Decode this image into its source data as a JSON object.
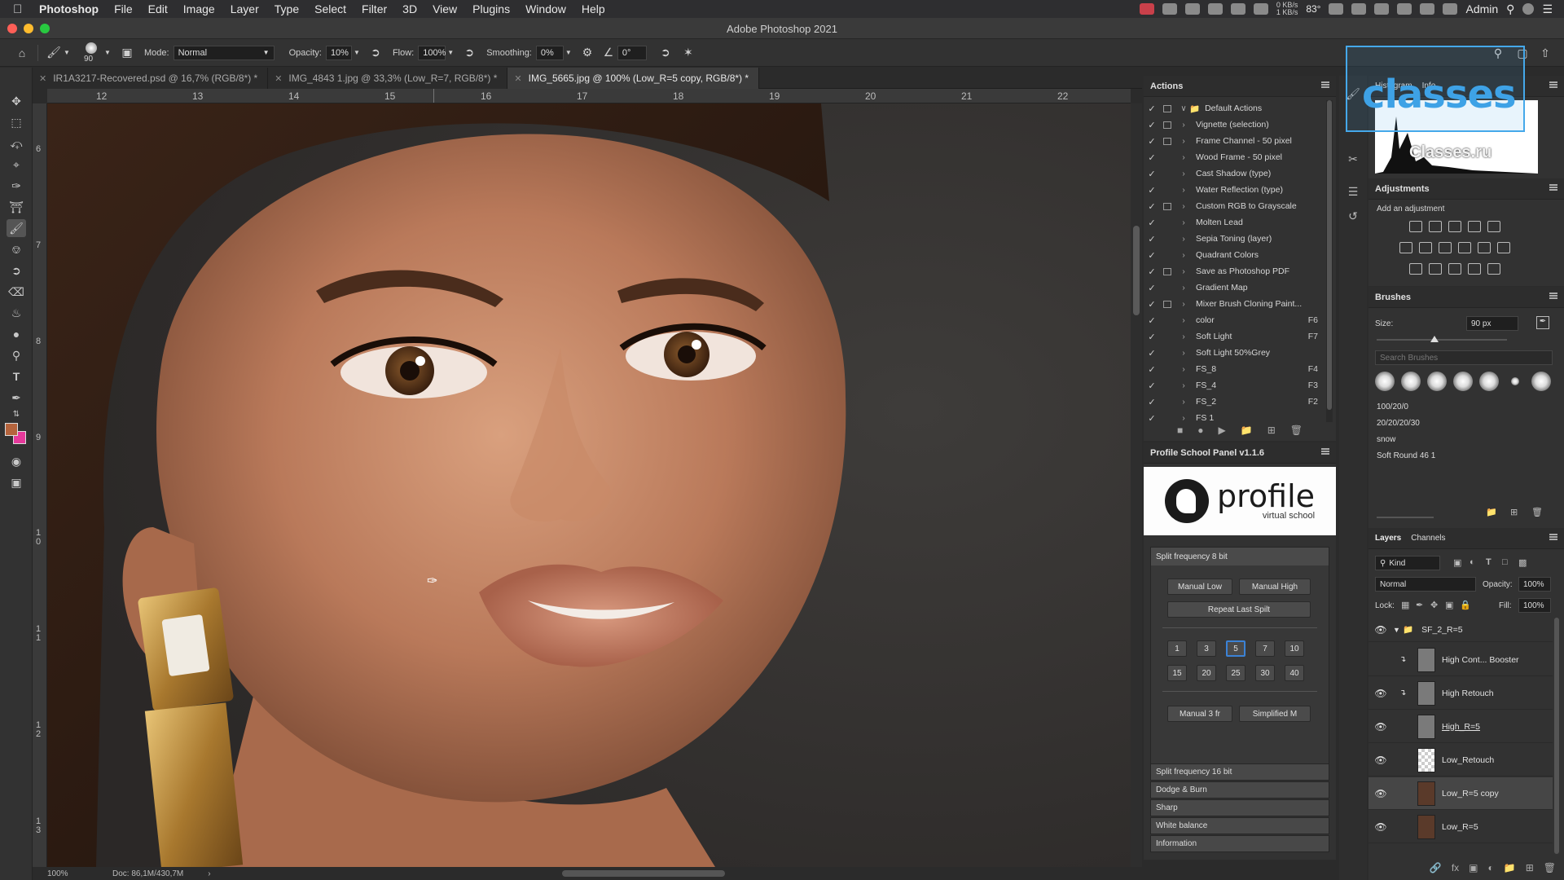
{
  "menubar": {
    "app": "Photoshop",
    "items": [
      "File",
      "Edit",
      "Image",
      "Layer",
      "Type",
      "Select",
      "Filter",
      "3D",
      "View",
      "Plugins",
      "Window",
      "Help"
    ],
    "net_up": "0 KB/s",
    "net_down": "1 KB/s",
    "temperature": "83°",
    "user": "Admin"
  },
  "window": {
    "title": "Adobe Photoshop 2021"
  },
  "options": {
    "brush_size": "90",
    "mode_label": "Mode:",
    "mode_value": "Normal",
    "opacity_label": "Opacity:",
    "opacity_value": "10%",
    "flow_label": "Flow:",
    "flow_value": "100%",
    "smoothing_label": "Smoothing:",
    "smoothing_value": "0%",
    "angle_value": "0°"
  },
  "tabs": [
    {
      "label": "IR1A3217-Recovered.psd @ 16,7% (RGB/8*) *"
    },
    {
      "label": "IMG_4843 1.jpg @ 33,3% (Low_R=7, RGB/8*) *"
    },
    {
      "label": "IMG_5665.jpg @ 100% (Low_R=5 copy, RGB/8*) *"
    }
  ],
  "ruler_top": [
    "12",
    "13",
    "14",
    "15",
    "16",
    "17",
    "18",
    "19",
    "20",
    "21",
    "22"
  ],
  "ruler_left": [
    "6",
    "7",
    "8",
    "9",
    "1\n0",
    "1\n1",
    "1\n2",
    "1\n3"
  ],
  "status": {
    "zoom": "100%",
    "doc": "Doc: 86,1M/430,7M"
  },
  "actions": {
    "title": "Actions",
    "items": [
      {
        "name": "Default Actions",
        "key": ""
      },
      {
        "name": "Vignette (selection)",
        "key": ""
      },
      {
        "name": "Frame Channel - 50 pixel",
        "key": ""
      },
      {
        "name": "Wood Frame - 50 pixel",
        "key": ""
      },
      {
        "name": "Cast Shadow (type)",
        "key": ""
      },
      {
        "name": "Water Reflection (type)",
        "key": ""
      },
      {
        "name": "Custom RGB to Grayscale",
        "key": ""
      },
      {
        "name": "Molten Lead",
        "key": ""
      },
      {
        "name": "Sepia Toning (layer)",
        "key": ""
      },
      {
        "name": "Quadrant Colors",
        "key": ""
      },
      {
        "name": "Save as Photoshop PDF",
        "key": ""
      },
      {
        "name": "Gradient Map",
        "key": ""
      },
      {
        "name": "Mixer Brush Cloning Paint...",
        "key": ""
      },
      {
        "name": "color",
        "key": "F6"
      },
      {
        "name": "Soft Light",
        "key": "F7"
      },
      {
        "name": "Soft Light 50%Grey",
        "key": ""
      },
      {
        "name": "FS_8",
        "key": "F4"
      },
      {
        "name": "FS_4",
        "key": "F3"
      },
      {
        "name": "FS_2",
        "key": "F2"
      },
      {
        "name": "FS 1",
        "key": ""
      }
    ]
  },
  "profile_panel": {
    "title": "Profile School Panel v1.1.6",
    "logo_word": "profile",
    "logo_sub": "virtual school",
    "section1": "Split frequency 8 bit",
    "manual_low": "Manual Low",
    "manual_high": "Manual High",
    "repeat_last": "Repeat Last Spilt",
    "radii": [
      "1",
      "3",
      "5",
      "7",
      "10",
      "15",
      "20",
      "25",
      "30",
      "40"
    ],
    "manual3": "Manual 3 fr",
    "simplified": "Simplified M",
    "sections": [
      "Split frequency 16 bit",
      "Dodge & Burn",
      "Sharp",
      "White balance",
      "Information"
    ]
  },
  "histogram": {
    "tab1": "Histogram",
    "tab2": "Info",
    "overlay_word": "classes",
    "overlay_sub": "Classes.ru"
  },
  "adjustments": {
    "title": "Adjustments",
    "subtitle": "Add an adjustment"
  },
  "brushes": {
    "title": "Brushes",
    "size_label": "Size:",
    "size_value": "90 px",
    "search_placeholder": "Search Brushes",
    "presets": [
      "100/20/0",
      "20/20/20/30",
      "snow",
      "Soft Round 46 1"
    ]
  },
  "layers": {
    "tab1": "Layers",
    "tab2": "Channels",
    "kind": "Kind",
    "blend": "Normal",
    "opacity_label": "Opacity:",
    "opacity_value": "100%",
    "lock_label": "Lock:",
    "fill_label": "Fill:",
    "fill_value": "100%",
    "group": "SF_2_R=5",
    "items": [
      {
        "name": "High Cont... Booster"
      },
      {
        "name": "High Retouch"
      },
      {
        "name": "High_R=5"
      },
      {
        "name": "Low_Retouch"
      },
      {
        "name": "Low_R=5 copy"
      },
      {
        "name": "Low_R=5"
      }
    ]
  },
  "colors": {
    "accent": "#3b82d6",
    "foreground": "#b5643d",
    "background": "#e6399b"
  }
}
